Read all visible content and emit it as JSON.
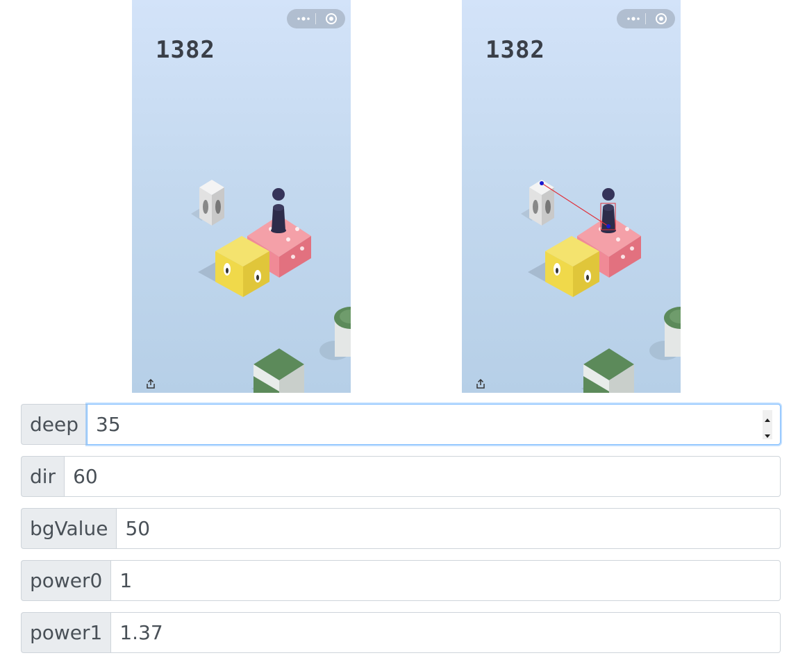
{
  "screenshots": [
    {
      "score": "1382",
      "annotated": false
    },
    {
      "score": "1382",
      "annotated": true
    }
  ],
  "fields": [
    {
      "label": "deep",
      "value": "35"
    },
    {
      "label": "dir",
      "value": "60"
    },
    {
      "label": "bgValue",
      "value": "50"
    },
    {
      "label": "power0",
      "value": "1"
    },
    {
      "label": "power1",
      "value": "1.37"
    }
  ],
  "icons": {
    "capsule_menu": "more-dots-icon",
    "capsule_close": "target-close-icon",
    "share": "share-icon"
  },
  "colors": {
    "input_focus_border": "#80bdff",
    "label_bg": "#e9ecef",
    "guide_line": "#e0303a",
    "guide_point": "#1a1ad0"
  }
}
